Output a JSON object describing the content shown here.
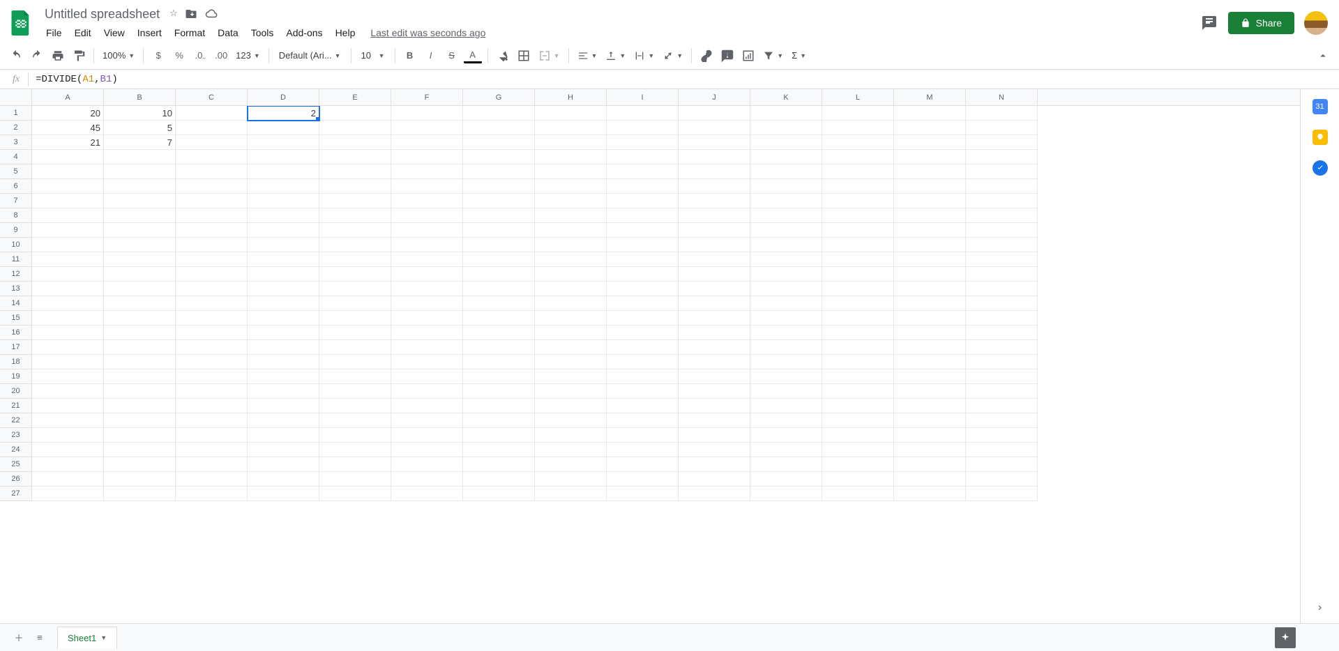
{
  "header": {
    "title": "Untitled spreadsheet",
    "last_edit": "Last edit was seconds ago"
  },
  "menu": [
    "File",
    "Edit",
    "View",
    "Insert",
    "Format",
    "Data",
    "Tools",
    "Add-ons",
    "Help"
  ],
  "toolbar": {
    "zoom": "100%",
    "font": "Default (Ari...",
    "font_size": "10",
    "number_fmt": "123"
  },
  "formula_bar": {
    "prefix": "=DIVIDE(",
    "ref1": "A1",
    "comma": ",",
    "ref2": "B1",
    "suffix": ")"
  },
  "share": {
    "label": "Share"
  },
  "columns": [
    "A",
    "B",
    "C",
    "D",
    "E",
    "F",
    "G",
    "H",
    "I",
    "J",
    "K",
    "L",
    "M",
    "N"
  ],
  "num_rows": 27,
  "selected_cell": "D1",
  "cell_data": {
    "A1": "20",
    "B1": "10",
    "D1": "2",
    "A2": "45",
    "B2": "5",
    "A3": "21",
    "B3": "7"
  },
  "sheet_tab": {
    "name": "Sheet1"
  },
  "side_panel": {
    "calendar_day": "31"
  }
}
